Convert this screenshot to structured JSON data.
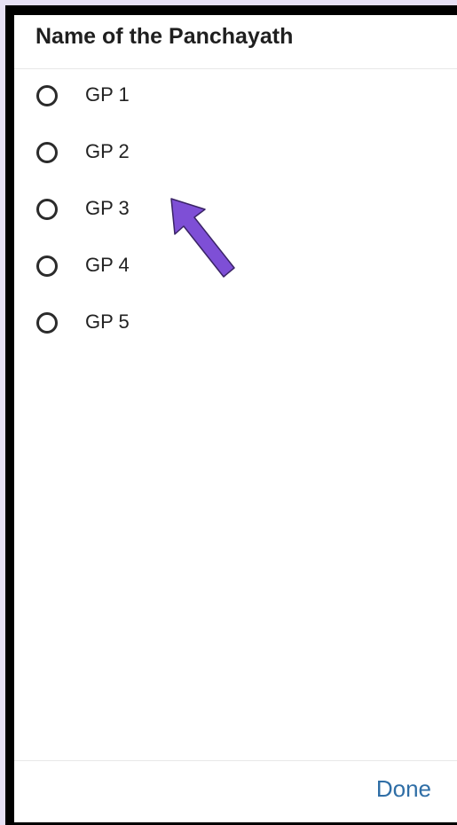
{
  "dialog": {
    "title": "Name of the Panchayath",
    "options": [
      {
        "label": "GP 1",
        "selected": false
      },
      {
        "label": "GP 2",
        "selected": false
      },
      {
        "label": "GP 3",
        "selected": false
      },
      {
        "label": "GP 4",
        "selected": false
      },
      {
        "label": "GP 5",
        "selected": false
      }
    ],
    "done_label": "Done"
  },
  "annotation": {
    "icon": "arrow-up-left-icon",
    "color": "#7e4fd6"
  },
  "colors": {
    "background": "#e6e0f4",
    "frame": "#000000",
    "accent": "#2f6ea6"
  }
}
